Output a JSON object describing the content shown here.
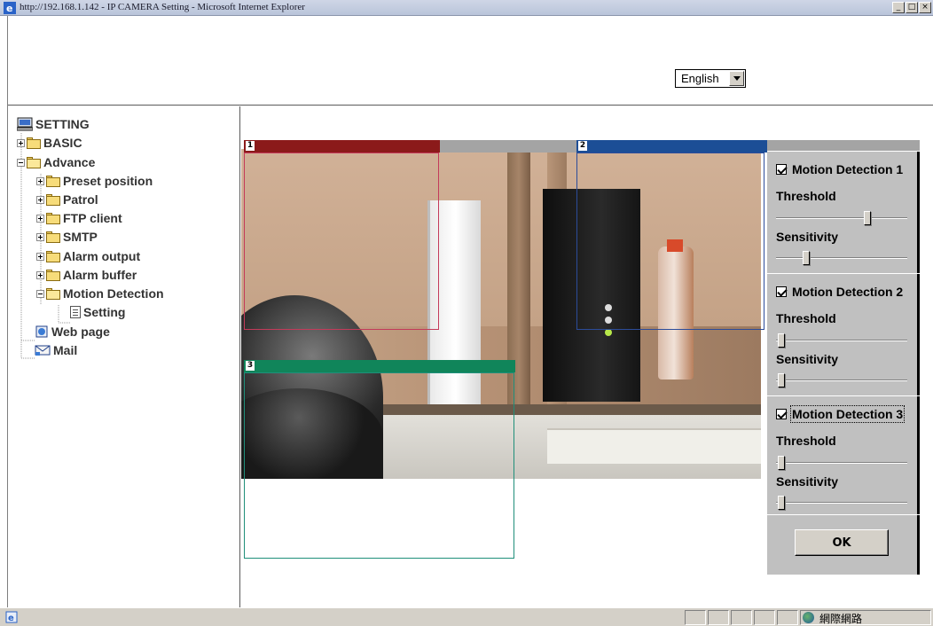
{
  "window": {
    "title": "http://192.168.1.142 - IP CAMERA Setting - Microsoft Internet Explorer",
    "minimize": "_",
    "maximize": "□",
    "close": "×"
  },
  "language_select": {
    "value": "English"
  },
  "tree": {
    "root": "SETTING",
    "basic": "BASIC",
    "advance": "Advance",
    "preset_position": "Preset position",
    "patrol": "Patrol",
    "ftp_client": "FTP client",
    "smtp": "SMTP",
    "alarm_output": "Alarm output",
    "alarm_buffer": "Alarm buffer",
    "motion_detection": "Motion Detection",
    "setting": "Setting",
    "web_page": "Web page",
    "mail": "Mail"
  },
  "zones": [
    {
      "number": "1",
      "color": "#8b1a1a"
    },
    {
      "number": "2",
      "color": "#1c4e96"
    },
    {
      "number": "3",
      "color": "#10855a"
    }
  ],
  "motion_panel": {
    "groups": [
      {
        "label": "Motion Detection 1",
        "checked": true,
        "threshold_label": "Threshold",
        "threshold": 0.7,
        "sensitivity_label": "Sensitivity",
        "sensitivity": 0.2
      },
      {
        "label": "Motion Detection 2",
        "checked": true,
        "threshold_label": "Threshold",
        "threshold": 0.0,
        "sensitivity_label": "Sensitivity",
        "sensitivity": 0.0
      },
      {
        "label": "Motion Detection 3",
        "checked": true,
        "threshold_label": "Threshold",
        "threshold": 0.0,
        "sensitivity_label": "Sensitivity",
        "sensitivity": 0.0
      }
    ],
    "ok_label": "OK"
  },
  "statusbar": {
    "zone_text": "網際網路"
  }
}
